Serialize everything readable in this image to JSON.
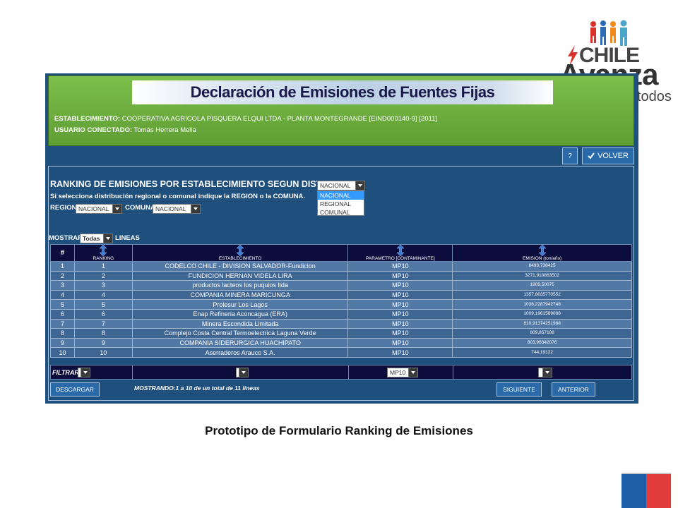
{
  "logo": {
    "line1": "CHILE",
    "line2": "Avanza",
    "line3": "todos"
  },
  "header": {
    "title": "Declaración de Emisiones de Fuentes Fijas",
    "establecimiento_label": "ESTABLECIMIENTO:",
    "establecimiento_value": "COOPERATIVA AGRICOLA PISQUERA ELQUI LTDA - PLANTA MONTEGRANDE [EIND000140-9] [2011]",
    "usuario_label": "USUARIO CONECTADO:",
    "usuario_value": "Tomás Herrera Mella"
  },
  "toolbar": {
    "help_label": "?",
    "volver_label": "VOLVER",
    "volver_icon": "check-icon"
  },
  "form": {
    "title": "RANKING DE EMISIONES POR ESTABLECIMIENTO SEGUN DISTRIBUCION",
    "subtitle": "Si selecciona distribución regional o comunal indique la REGION o la COMUNA.",
    "distribucion_value": "NACIONAL",
    "distribucion_options": [
      "NACIONAL",
      "REGIONAL",
      "COMUNAL"
    ],
    "region_label": "REGION:",
    "region_value": "NACIONAL",
    "comuna_label": "COMUNA",
    "comuna_value": "NACIONAL",
    "mostrar_label": "MOSTRAR",
    "mostrar_value": "Todas",
    "lineas_label": "LINEAS"
  },
  "table": {
    "columns": [
      "#",
      "RANKING",
      "ESTABLECIMIENTO",
      "PARAMETRO [CONTAMINANTE]",
      "EMISION (ton/año)"
    ],
    "rows": [
      [
        "1",
        "1",
        "CODELCO CHILE - DIVISION SALVADOR-Fundicion",
        "MP10",
        "8493,738425"
      ],
      [
        "2",
        "2",
        "FUNDICION HERNAN VIDELA LIRA",
        "MP10",
        "3271,910863502"
      ],
      [
        "3",
        "3",
        "productos lacteos los puquios ltda",
        "MP10",
        "1909,50075"
      ],
      [
        "4",
        "4",
        "COMPANIA MINERA MARICUNGA",
        "MP10",
        "1357,8035770552"
      ],
      [
        "5",
        "5",
        "Prolesur Los Lagos",
        "MP10",
        "1036,2287942748"
      ],
      [
        "6",
        "6",
        "Enap Refineria Aconcagua (ERA)",
        "MP10",
        "1009,1961589088"
      ],
      [
        "7",
        "7",
        "Minera Escondida Limitada",
        "MP10",
        "810,91374251988"
      ],
      [
        "8",
        "8",
        "Complejo Costa Central Termoelectrica Laguna Verde",
        "MP10",
        "809,857188"
      ],
      [
        "9",
        "9",
        "COMPANIA SIDERURGICA HUACHIPATO",
        "MP10",
        "803,96342076"
      ],
      [
        "10",
        "10",
        "Aserraderos Arauco S.A.",
        "MP10",
        "744,19122"
      ]
    ],
    "filtrar_label": "FILTRAR",
    "filter_parametro_value": "MP10"
  },
  "footer": {
    "descargar_label": "DESCARGAR",
    "mostrando_text": "MOSTRANDO:1 a 10 de un total de 11 lineas",
    "siguiente_label": "SIGUIENTE",
    "anterior_label": "ANTERIOR"
  },
  "caption": "Prototipo de Formulario Ranking de Emisiones"
}
